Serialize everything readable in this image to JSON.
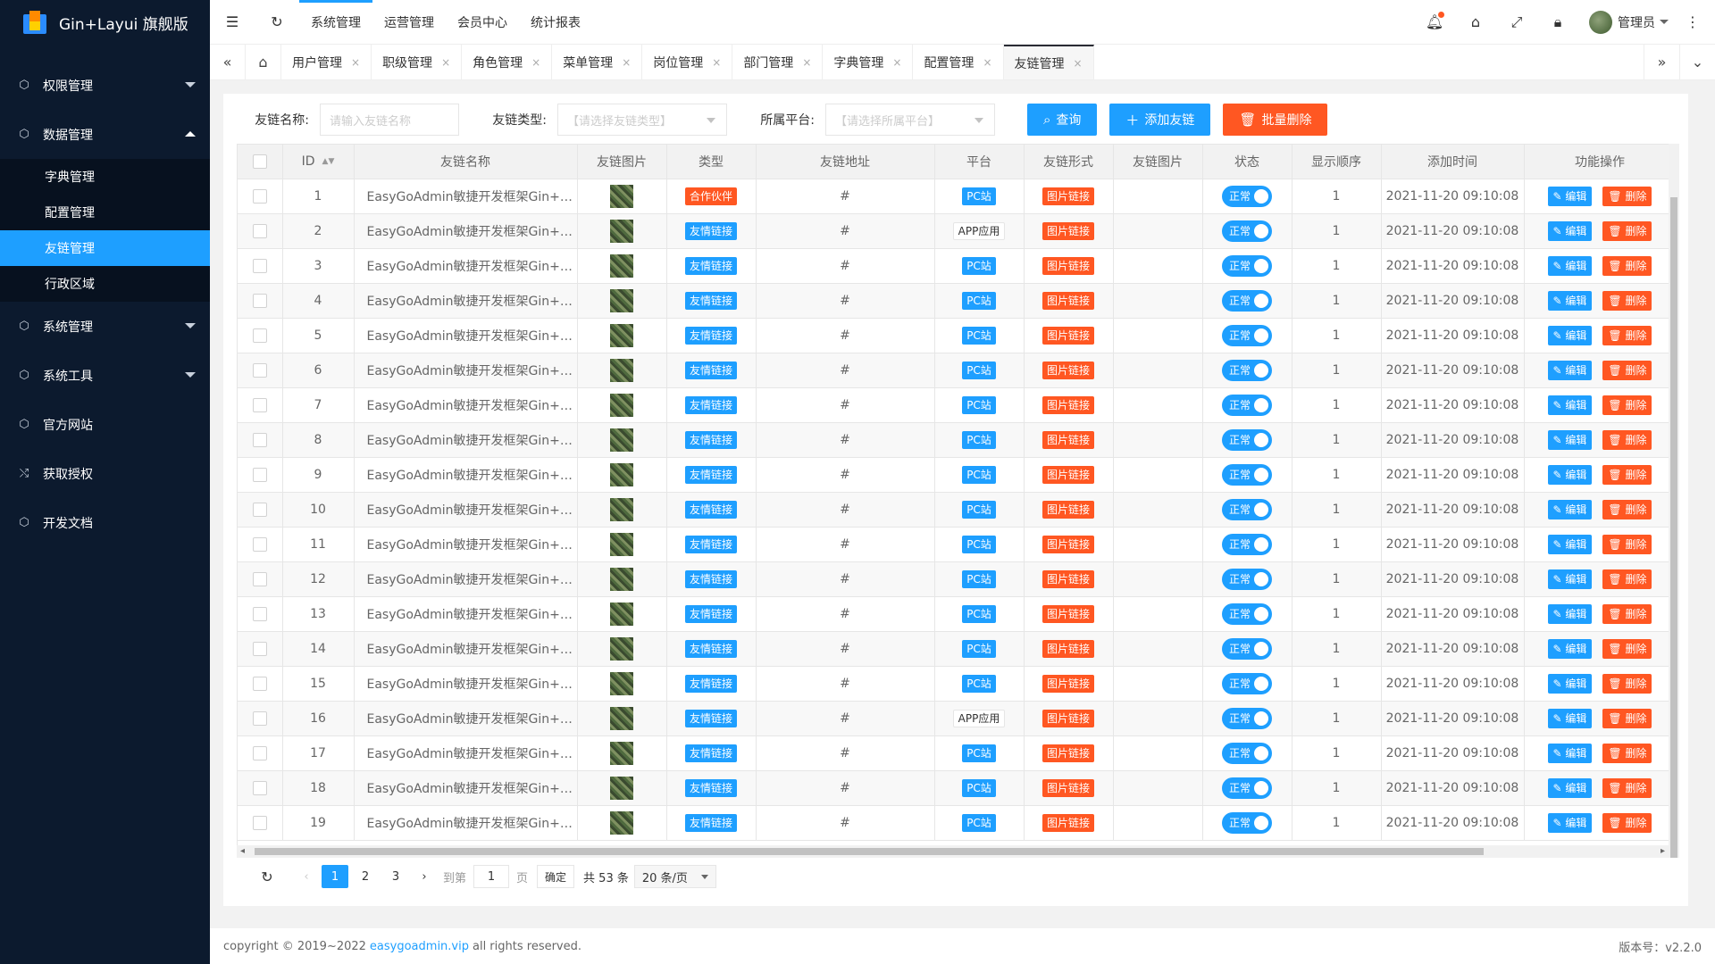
{
  "app": {
    "title": "Gin+Layui 旗舰版"
  },
  "sidebar": {
    "items": [
      {
        "label": "权限管理",
        "icon": "cube-icon",
        "expanded": false
      },
      {
        "label": "数据管理",
        "icon": "cube-icon",
        "expanded": true,
        "children": [
          {
            "label": "字典管理",
            "active": false
          },
          {
            "label": "配置管理",
            "active": false
          },
          {
            "label": "友链管理",
            "active": true
          },
          {
            "label": "行政区域",
            "active": false
          }
        ]
      },
      {
        "label": "系统管理",
        "icon": "cube-icon",
        "expanded": false
      },
      {
        "label": "系统工具",
        "icon": "cube-icon",
        "expanded": false
      },
      {
        "label": "官方网站",
        "icon": "cube-icon"
      },
      {
        "label": "获取授权",
        "icon": "branch-icon"
      },
      {
        "label": "开发文档",
        "icon": "cube-icon"
      }
    ]
  },
  "header": {
    "nav": [
      "系统管理",
      "运营管理",
      "会员中心",
      "统计报表"
    ],
    "active_nav": 0,
    "user": "管理员"
  },
  "tabs": {
    "items": [
      "用户管理",
      "职级管理",
      "角色管理",
      "菜单管理",
      "岗位管理",
      "部门管理",
      "字典管理",
      "配置管理",
      "友链管理"
    ],
    "active": 8
  },
  "search": {
    "name_label": "友链名称:",
    "name_placeholder": "请输入友链名称",
    "type_label": "友链类型:",
    "type_placeholder": "【请选择友链类型】",
    "platform_label": "所属平台:",
    "platform_placeholder": "【请选择所属平台】",
    "query_btn": "查询",
    "add_btn": "添加友链",
    "batch_delete_btn": "批量删除"
  },
  "table": {
    "columns": [
      "ID",
      "友链名称",
      "友链图片",
      "类型",
      "友链地址",
      "平台",
      "友链形式",
      "友链图片",
      "状态",
      "显示顺序",
      "添加时间",
      "功能操作"
    ],
    "edit_label": "编辑",
    "delete_label": "删除",
    "rows": [
      {
        "id": "1",
        "name": "EasyGoAdmin敏捷开发框架Gin+Layui",
        "type": "合作伙伴",
        "type_color": "red",
        "url": "#",
        "platform": "PC站",
        "platform_style": "blue",
        "form": "图片链接",
        "status": "正常",
        "order": "1",
        "time": "2021-11-20 09:10:08"
      },
      {
        "id": "2",
        "name": "EasyGoAdmin敏捷开发框架Gin+Layui",
        "type": "友情链接",
        "type_color": "blue",
        "url": "#",
        "platform": "APP应用",
        "platform_style": "plain",
        "form": "图片链接",
        "status": "正常",
        "order": "1",
        "time": "2021-11-20 09:10:08"
      },
      {
        "id": "3",
        "name": "EasyGoAdmin敏捷开发框架Gin+Layui",
        "type": "友情链接",
        "type_color": "blue",
        "url": "#",
        "platform": "PC站",
        "platform_style": "blue",
        "form": "图片链接",
        "status": "正常",
        "order": "1",
        "time": "2021-11-20 09:10:08"
      },
      {
        "id": "4",
        "name": "EasyGoAdmin敏捷开发框架Gin+Layui",
        "type": "友情链接",
        "type_color": "blue",
        "url": "#",
        "platform": "PC站",
        "platform_style": "blue",
        "form": "图片链接",
        "status": "正常",
        "order": "1",
        "time": "2021-11-20 09:10:08"
      },
      {
        "id": "5",
        "name": "EasyGoAdmin敏捷开发框架Gin+Layui",
        "type": "友情链接",
        "type_color": "blue",
        "url": "#",
        "platform": "PC站",
        "platform_style": "blue",
        "form": "图片链接",
        "status": "正常",
        "order": "1",
        "time": "2021-11-20 09:10:08"
      },
      {
        "id": "6",
        "name": "EasyGoAdmin敏捷开发框架Gin+Layui",
        "type": "友情链接",
        "type_color": "blue",
        "url": "#",
        "platform": "PC站",
        "platform_style": "blue",
        "form": "图片链接",
        "status": "正常",
        "order": "1",
        "time": "2021-11-20 09:10:08"
      },
      {
        "id": "7",
        "name": "EasyGoAdmin敏捷开发框架Gin+Layui",
        "type": "友情链接",
        "type_color": "blue",
        "url": "#",
        "platform": "PC站",
        "platform_style": "blue",
        "form": "图片链接",
        "status": "正常",
        "order": "1",
        "time": "2021-11-20 09:10:08"
      },
      {
        "id": "8",
        "name": "EasyGoAdmin敏捷开发框架Gin+Layui",
        "type": "友情链接",
        "type_color": "blue",
        "url": "#",
        "platform": "PC站",
        "platform_style": "blue",
        "form": "图片链接",
        "status": "正常",
        "order": "1",
        "time": "2021-11-20 09:10:08"
      },
      {
        "id": "9",
        "name": "EasyGoAdmin敏捷开发框架Gin+Layui",
        "type": "友情链接",
        "type_color": "blue",
        "url": "#",
        "platform": "PC站",
        "platform_style": "blue",
        "form": "图片链接",
        "status": "正常",
        "order": "1",
        "time": "2021-11-20 09:10:08"
      },
      {
        "id": "10",
        "name": "EasyGoAdmin敏捷开发框架Gin+Layui",
        "type": "友情链接",
        "type_color": "blue",
        "url": "#",
        "platform": "PC站",
        "platform_style": "blue",
        "form": "图片链接",
        "status": "正常",
        "order": "1",
        "time": "2021-11-20 09:10:08"
      },
      {
        "id": "11",
        "name": "EasyGoAdmin敏捷开发框架Gin+Layui",
        "type": "友情链接",
        "type_color": "blue",
        "url": "#",
        "platform": "PC站",
        "platform_style": "blue",
        "form": "图片链接",
        "status": "正常",
        "order": "1",
        "time": "2021-11-20 09:10:08"
      },
      {
        "id": "12",
        "name": "EasyGoAdmin敏捷开发框架Gin+Layui",
        "type": "友情链接",
        "type_color": "blue",
        "url": "#",
        "platform": "PC站",
        "platform_style": "blue",
        "form": "图片链接",
        "status": "正常",
        "order": "1",
        "time": "2021-11-20 09:10:08"
      },
      {
        "id": "13",
        "name": "EasyGoAdmin敏捷开发框架Gin+Layui",
        "type": "友情链接",
        "type_color": "blue",
        "url": "#",
        "platform": "PC站",
        "platform_style": "blue",
        "form": "图片链接",
        "status": "正常",
        "order": "1",
        "time": "2021-11-20 09:10:08"
      },
      {
        "id": "14",
        "name": "EasyGoAdmin敏捷开发框架Gin+Layui",
        "type": "友情链接",
        "type_color": "blue",
        "url": "#",
        "platform": "PC站",
        "platform_style": "blue",
        "form": "图片链接",
        "status": "正常",
        "order": "1",
        "time": "2021-11-20 09:10:08"
      },
      {
        "id": "15",
        "name": "EasyGoAdmin敏捷开发框架Gin+Layui",
        "type": "友情链接",
        "type_color": "blue",
        "url": "#",
        "platform": "PC站",
        "platform_style": "blue",
        "form": "图片链接",
        "status": "正常",
        "order": "1",
        "time": "2021-11-20 09:10:08"
      },
      {
        "id": "16",
        "name": "EasyGoAdmin敏捷开发框架Gin+Layui",
        "type": "友情链接",
        "type_color": "blue",
        "url": "#",
        "platform": "APP应用",
        "platform_style": "plain",
        "form": "图片链接",
        "status": "正常",
        "order": "1",
        "time": "2021-11-20 09:10:08"
      },
      {
        "id": "17",
        "name": "EasyGoAdmin敏捷开发框架Gin+Layui",
        "type": "友情链接",
        "type_color": "blue",
        "url": "#",
        "platform": "PC站",
        "platform_style": "blue",
        "form": "图片链接",
        "status": "正常",
        "order": "1",
        "time": "2021-11-20 09:10:08"
      },
      {
        "id": "18",
        "name": "EasyGoAdmin敏捷开发框架Gin+Layui",
        "type": "友情链接",
        "type_color": "blue",
        "url": "#",
        "platform": "PC站",
        "platform_style": "blue",
        "form": "图片链接",
        "status": "正常",
        "order": "1",
        "time": "2021-11-20 09:10:08"
      },
      {
        "id": "19",
        "name": "EasyGoAdmin敏捷开发框架Gin+Layui",
        "type": "友情链接",
        "type_color": "blue",
        "url": "#",
        "platform": "PC站",
        "platform_style": "blue",
        "form": "图片链接",
        "status": "正常",
        "order": "1",
        "time": "2021-11-20 09:10:08"
      }
    ]
  },
  "pager": {
    "pages": [
      "1",
      "2",
      "3"
    ],
    "current": "1",
    "goto_label": "到第",
    "goto_value": "1",
    "page_unit": "页",
    "confirm": "确定",
    "total": "共 53 条",
    "page_size": "20 条/页"
  },
  "footer": {
    "copyright_prefix": "copyright © 2019~2022",
    "link": "easygoadmin.vip",
    "copyright_suffix": "all rights reserved.",
    "version": "版本号：v2.2.0"
  },
  "colors": {
    "primary": "#1e9fff",
    "danger": "#ff5722",
    "sidebar_bg": "#0c1a2e"
  }
}
